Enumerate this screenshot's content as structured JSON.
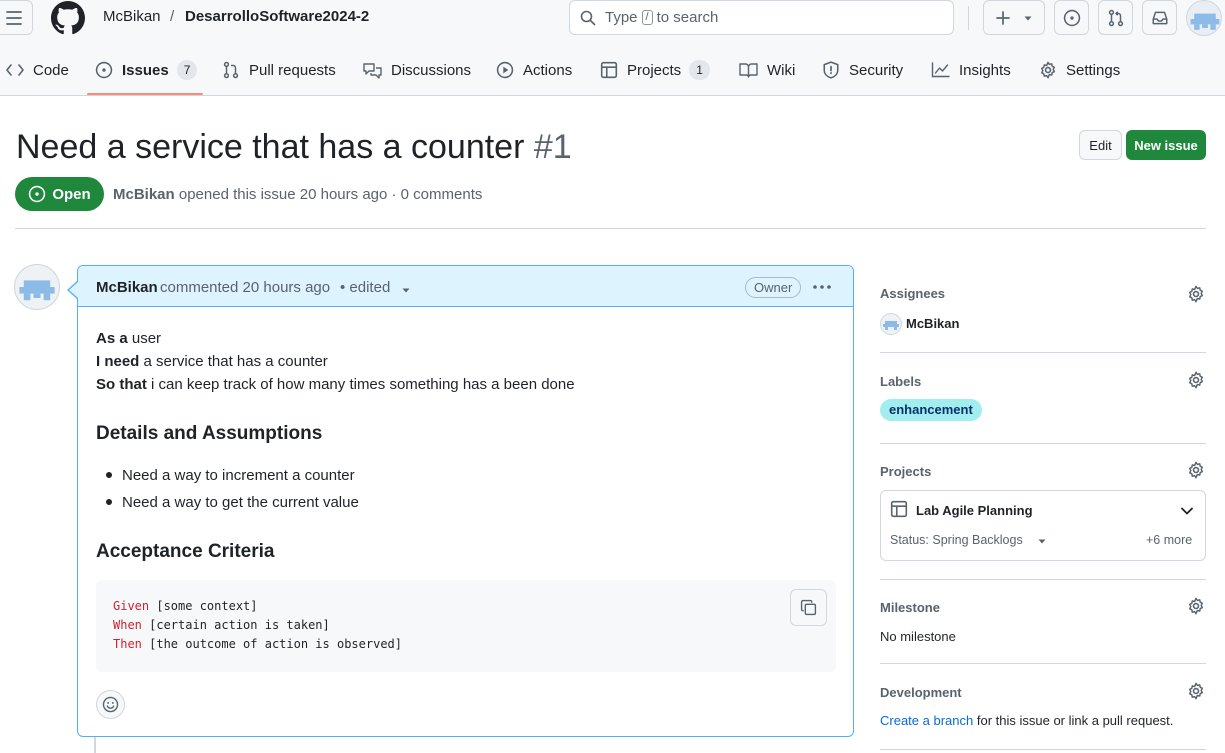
{
  "header": {
    "owner": "McBikan",
    "separator": "/",
    "repo": "DesarrolloSoftware2024-2",
    "search": {
      "prefix": "Type",
      "key": "/",
      "suffix": "to search"
    }
  },
  "tabs": [
    {
      "label": "Code"
    },
    {
      "label": "Issues",
      "count": "7"
    },
    {
      "label": "Pull requests"
    },
    {
      "label": "Discussions"
    },
    {
      "label": "Actions"
    },
    {
      "label": "Projects",
      "count": "1"
    },
    {
      "label": "Wiki"
    },
    {
      "label": "Security"
    },
    {
      "label": "Insights"
    },
    {
      "label": "Settings"
    }
  ],
  "issue": {
    "title": "Need a service that has a counter",
    "number": "#1",
    "state": "Open",
    "author": "McBikan",
    "meta": "opened this issue 20 hours ago · 0 comments",
    "edit_label": "Edit",
    "new_issue_label": "New issue"
  },
  "comment": {
    "author": "McBikan",
    "meta": "commented 20 hours ago",
    "edited": "• edited",
    "role": "Owner",
    "story": [
      {
        "bold": "As a",
        "rest": " user"
      },
      {
        "bold": "I need",
        "rest": " a service that has a counter"
      },
      {
        "bold": "So that",
        "rest": " i can keep track of how many times something has a been done"
      }
    ],
    "details_heading": "Details and Assumptions",
    "details": [
      "Need a way to increment a counter",
      "Need a way to get the current value"
    ],
    "criteria_heading": "Acceptance Criteria",
    "code": [
      {
        "kw": "Given",
        "rest": " [some context]"
      },
      {
        "kw": "When",
        "rest": " [certain action is taken]"
      },
      {
        "kw": "Then",
        "rest": " [the outcome of action is observed]"
      }
    ]
  },
  "sidebar": {
    "assignees": {
      "heading": "Assignees",
      "user": "McBikan"
    },
    "labels": {
      "heading": "Labels",
      "label": "enhancement",
      "label_color": "#a2eeef"
    },
    "projects": {
      "heading": "Projects",
      "name": "Lab Agile Planning",
      "status": "Status: Spring Backlogs",
      "more": "+6 more"
    },
    "milestone": {
      "heading": "Milestone",
      "value": "No milestone"
    },
    "development": {
      "heading": "Development",
      "link": "Create a branch",
      "rest": "for this issue or link a pull request."
    }
  },
  "colors": {
    "accent": "#1f883d",
    "link": "#0969da",
    "comment_head": "#ddf4ff",
    "comment_border": "#54aeff",
    "active_tab": "#fd8c73"
  }
}
